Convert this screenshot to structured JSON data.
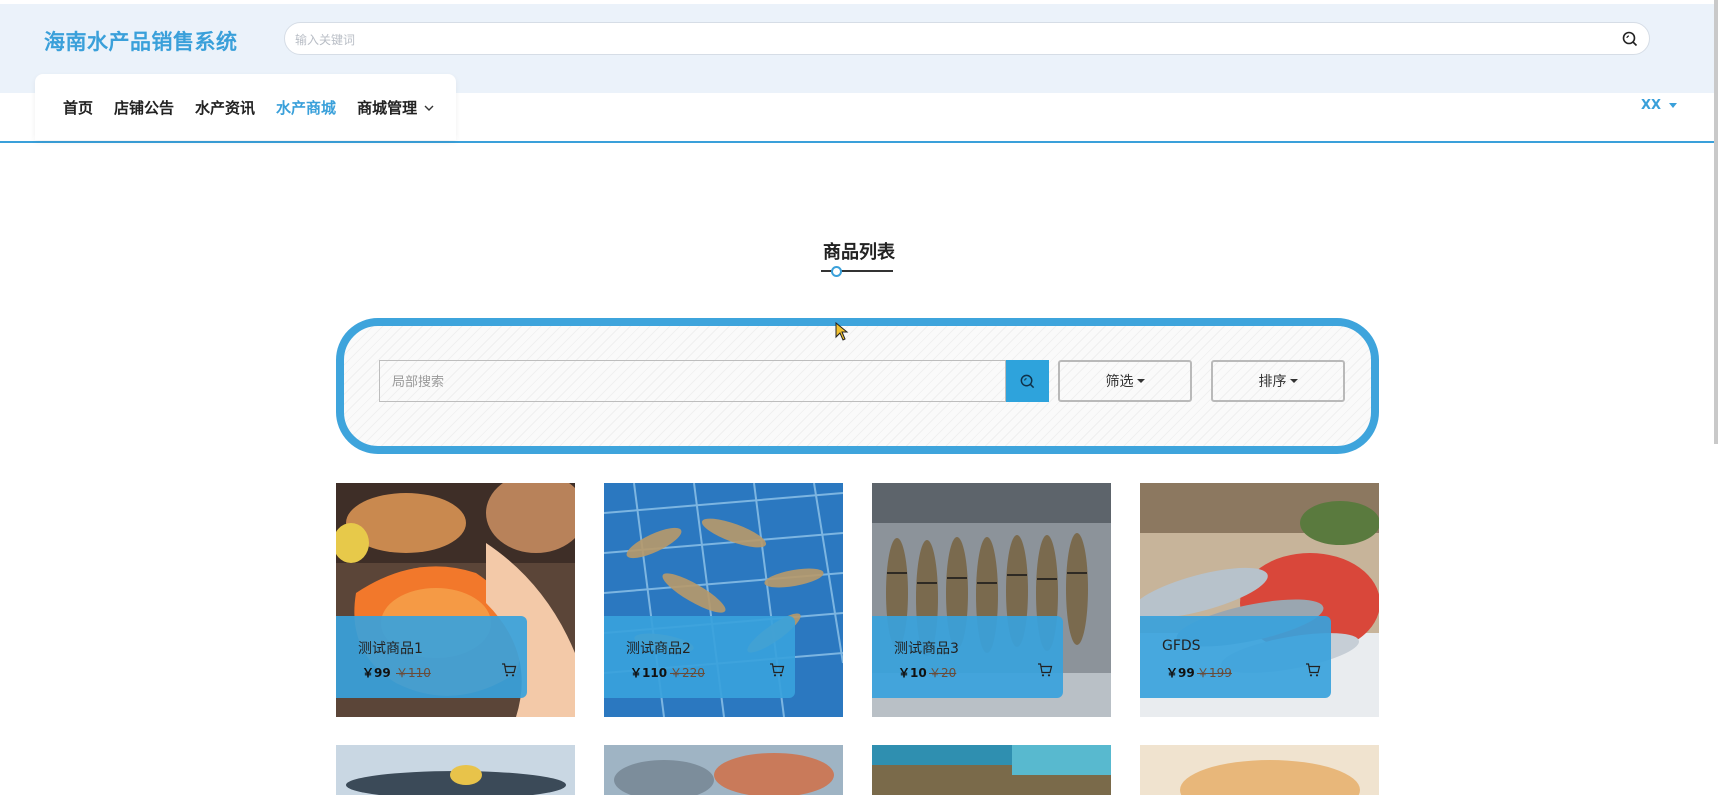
{
  "site": {
    "title": "海南水产品销售系统"
  },
  "global_search": {
    "placeholder": "输入关键词"
  },
  "nav": {
    "items": [
      {
        "label": "首页",
        "active": false
      },
      {
        "label": "店铺公告",
        "active": false
      },
      {
        "label": "水产资讯",
        "active": false
      },
      {
        "label": "水产商城",
        "active": true
      },
      {
        "label": "商城管理",
        "active": false,
        "has_dropdown": true
      }
    ],
    "user": "XX"
  },
  "section": {
    "title": "商品列表"
  },
  "local_search": {
    "placeholder": "局部搜索",
    "filter_label": "筛选",
    "sort_label": "排序"
  },
  "products": [
    {
      "name": "测试商品1",
      "price": "￥99",
      "old_price": "￥110",
      "image": "shrimp-in-hand"
    },
    {
      "name": "测试商品2",
      "price": "￥110",
      "old_price": "￥220",
      "image": "mantis-shrimp-tank"
    },
    {
      "name": "测试商品3",
      "price": "￥10",
      "old_price": "￥20",
      "image": "prawns-on-ice"
    },
    {
      "name": "GFDS",
      "price": "￥99",
      "old_price": "￥199",
      "image": "fish-platter"
    }
  ],
  "colors": {
    "accent": "#3aa0da",
    "header_bg": "#ebf2fa",
    "info_box": "#38a2dc"
  }
}
